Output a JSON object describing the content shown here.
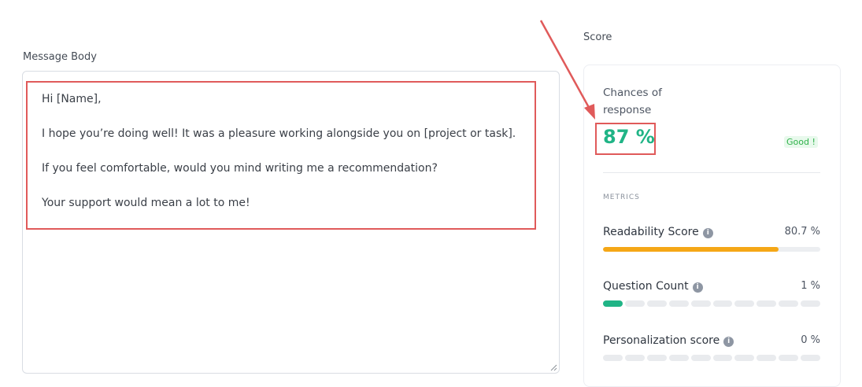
{
  "message": {
    "label": "Message Body",
    "lines": [
      "Hi [Name],",
      "I hope you’re doing well! It was a pleasure working alongside you on [project or task].",
      "If you feel comfortable, would you mind writing me a recommendation?",
      "Your support would mean a lot to me!"
    ]
  },
  "score": {
    "section_label": "Score",
    "chances_label": "Chances of response",
    "chances_value": "87 %",
    "rating": "Good !",
    "metrics_title": "METRICS",
    "metrics": [
      {
        "name": "Readability Score",
        "value": "80.7 %",
        "fraction": 0.807,
        "color": "#f5a716"
      },
      {
        "name": "Question Count",
        "value": "1 %",
        "segments_total": 10,
        "segments_on": 1,
        "color": "#20b486"
      },
      {
        "name": "Personalization score",
        "value": "0 %",
        "segments_total": 10,
        "segments_on": 0
      }
    ]
  },
  "colors": {
    "accent_green": "#20b486",
    "annotation_red": "#e05a5a",
    "warning_orange": "#f5a716"
  }
}
